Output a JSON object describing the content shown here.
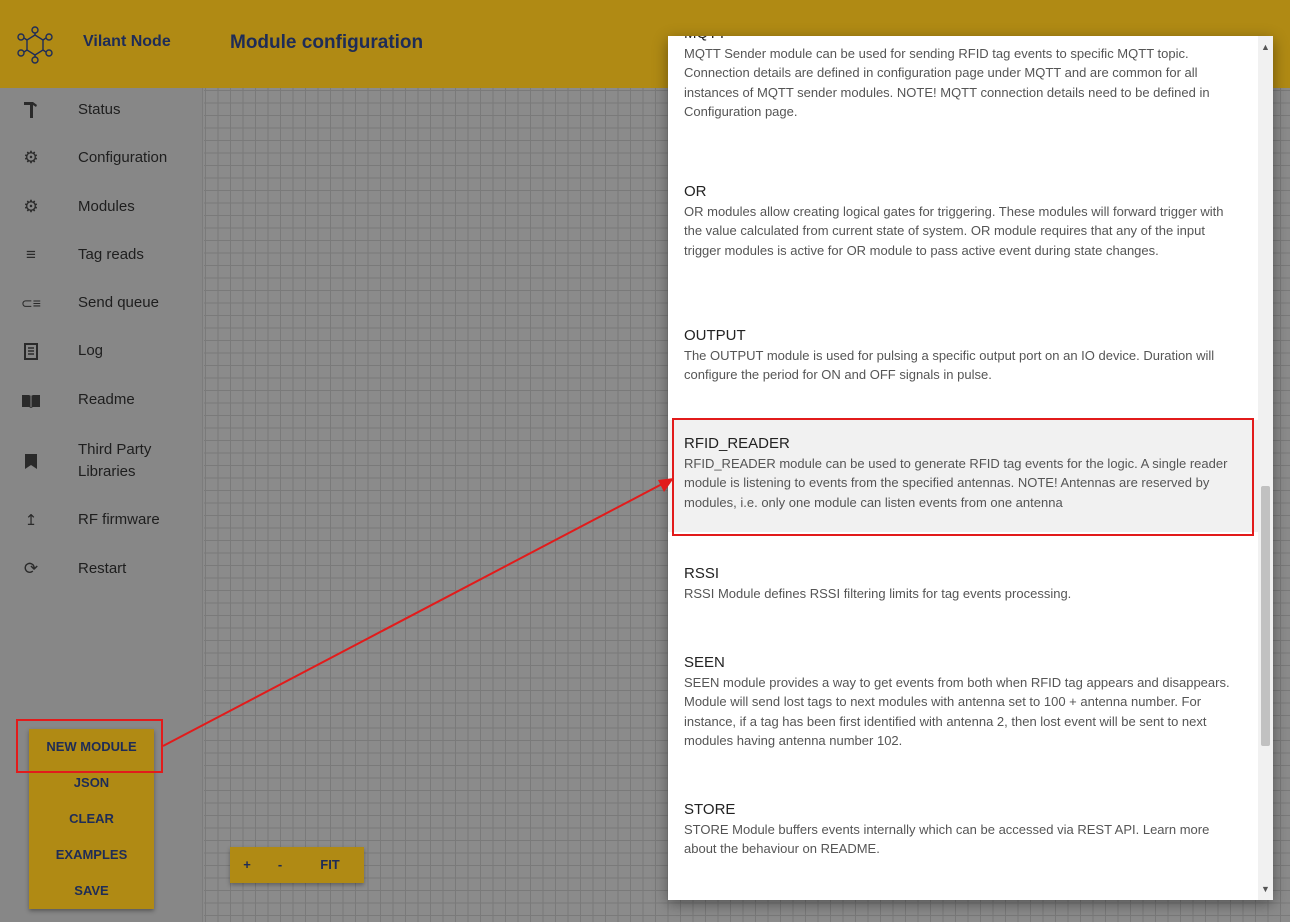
{
  "header": {
    "app_name": "Vilant Node",
    "page_title": "Module configuration",
    "logo_icon": "network-hexagon-icon",
    "color": "#b08a14"
  },
  "sidebar": {
    "items": [
      {
        "label": "Status",
        "icon": "hammer-icon"
      },
      {
        "label": "Configuration",
        "icon": "gear-icon"
      },
      {
        "label": "Modules",
        "icon": "gear-icon"
      },
      {
        "label": "Tag reads",
        "icon": "list-icon"
      },
      {
        "label": "Send queue",
        "icon": "queue-icon"
      },
      {
        "label": "Log",
        "icon": "log-icon"
      },
      {
        "label": "Readme",
        "icon": "book-icon"
      },
      {
        "label": "Third Party Libraries",
        "icon": "bookmark-book-icon"
      },
      {
        "label": "RF firmware",
        "icon": "upload-icon"
      },
      {
        "label": "Restart",
        "icon": "restart-icon"
      }
    ]
  },
  "actions": {
    "new_module": "NEW MODULE",
    "json": "JSON",
    "clear": "CLEAR",
    "examples": "EXAMPLES",
    "save": "SAVE"
  },
  "zoom": {
    "plus": "+",
    "minus": "-",
    "fit": "FIT"
  },
  "modules": [
    {
      "name": "MQTT",
      "desc": "MQTT Sender module can be used for sending RFID tag events to specific MQTT topic. Connection details are defined in configuration page under MQTT and are common for all instances of MQTT sender modules. NOTE! MQTT connection details need to be defined in Configuration page."
    },
    {
      "name": "OR",
      "desc": "OR modules allow creating logical gates for triggering. These modules will forward trigger with the value calculated from current state of system. OR module requires that any of the input trigger modules is active for OR module to pass active event during state changes."
    },
    {
      "name": "OUTPUT",
      "desc": "The OUTPUT module is used for pulsing a specific output port on an IO device. Duration will configure the period for ON and OFF signals in pulse."
    },
    {
      "name": "RFID_READER",
      "desc": "RFID_READER module can be used to generate RFID tag events for the logic. A single reader module is listening to events from the specified antennas. NOTE! Antennas are reserved by modules, i.e. only one module can listen events from one antenna"
    },
    {
      "name": "RSSI",
      "desc": "RSSI Module defines RSSI filtering limits for tag events processing."
    },
    {
      "name": "SEEN",
      "desc": "SEEN module provides a way to get events from both when RFID tag appears and disappears. Module will send lost tags to next modules with antenna set to 100 + antenna number. For instance, if a tag has been first identified with antenna 2, then lost event will be sent to next modules having antenna number 102."
    },
    {
      "name": "STORE",
      "desc": "STORE Module buffers events internally which can be accessed via REST API. Learn more about the behaviour on README."
    }
  ],
  "annotation_color": "#e21b1b"
}
